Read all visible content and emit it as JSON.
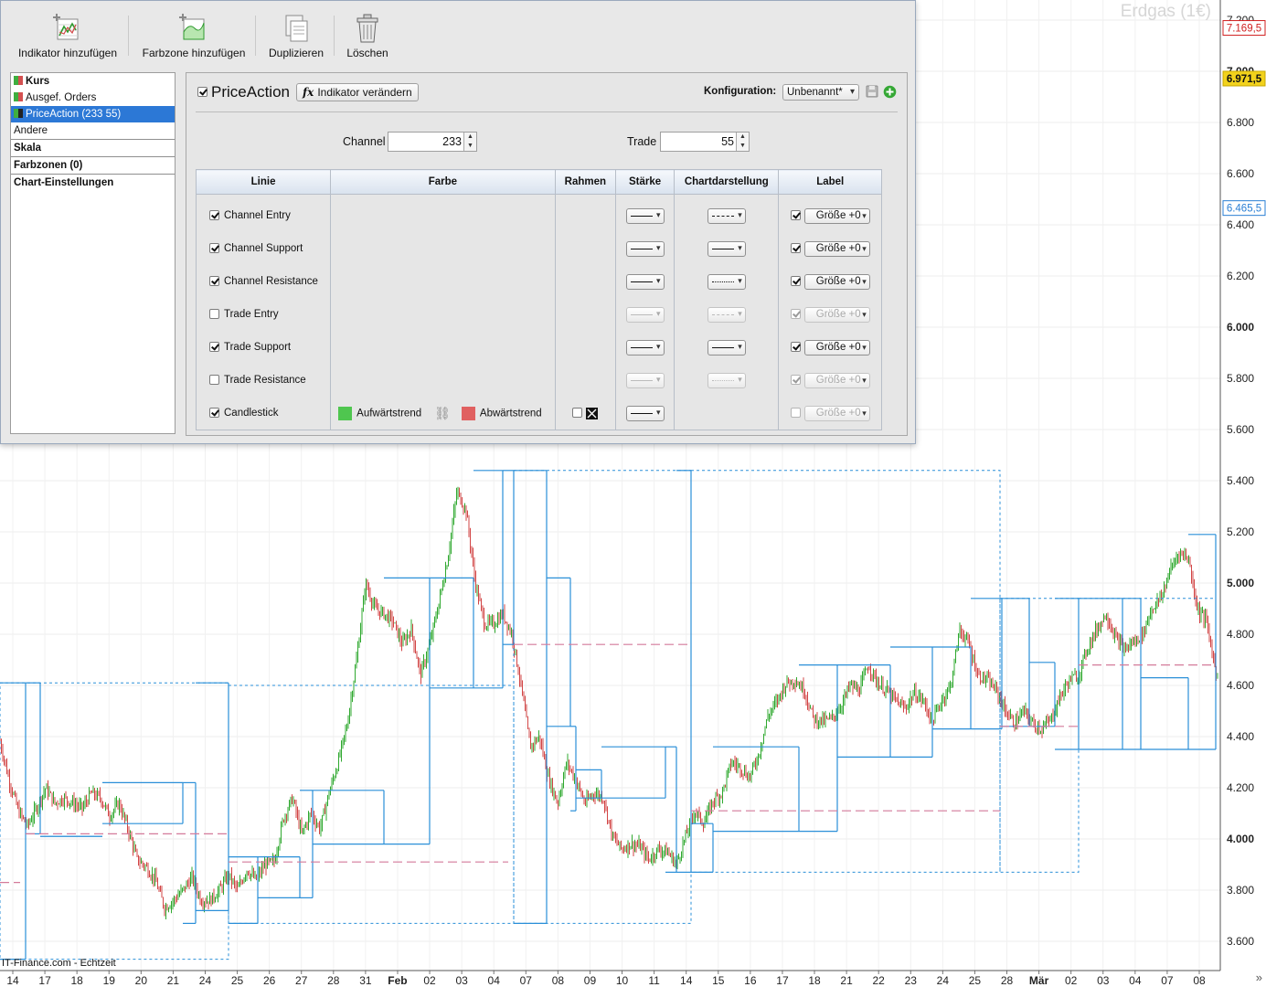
{
  "chart": {
    "watermark": "Erdgas (1€)",
    "source": "IT-Finance.com - Echtzeit",
    "y_ticks": [
      "7.200",
      "7.000",
      "6.800",
      "6.600",
      "6.400",
      "6.200",
      "6.000",
      "5.800",
      "5.600",
      "5.400",
      "5.200",
      "5.000",
      "4.800",
      "4.600",
      "4.400",
      "4.200",
      "4.000",
      "3.800",
      "3.600"
    ],
    "y_bold": [
      "7.000",
      "6.000",
      "5.000",
      "4.000"
    ],
    "price_badges": [
      {
        "label": "7.169,5",
        "value": 7169.5,
        "bg": "#ffffff",
        "fg": "#d02020",
        "border": "#d02020"
      },
      {
        "label": "6.971,5",
        "value": 6971.5,
        "bg": "#f2d21c",
        "fg": "#111111",
        "border": "#c7a700"
      },
      {
        "label": "6.465,5",
        "value": 6465.5,
        "bg": "#ffffff",
        "fg": "#2a7fd4",
        "border": "#2a7fd4"
      }
    ],
    "x_ticks": [
      "14",
      "17",
      "18",
      "19",
      "20",
      "21",
      "24",
      "25",
      "26",
      "27",
      "28",
      "31",
      "Feb",
      "02",
      "03",
      "04",
      "07",
      "08",
      "09",
      "10",
      "11",
      "14",
      "15",
      "16",
      "17",
      "18",
      "21",
      "22",
      "23",
      "24",
      "25",
      "28",
      "Mär",
      "02",
      "03",
      "04",
      "07",
      "08"
    ],
    "x_bold": [
      "Feb",
      "Mär"
    ],
    "colors": {
      "up": "#2fa82f",
      "down": "#d24545",
      "channel": "#2a8fd8",
      "midline": "#d47a9a"
    }
  },
  "chart_data": {
    "type": "candlestick",
    "ylim": [
      3500,
      7230
    ],
    "channel": [
      {
        "x0": 0,
        "x1": 28,
        "top": 4610,
        "bottom": 3530
      },
      {
        "x0": 28,
        "x1": 44,
        "top": 4610,
        "bottom": 4020
      },
      {
        "x0": 44,
        "x1": 112,
        "top": 4010,
        "bottom": 4010
      },
      {
        "x0": 112,
        "x1": 200,
        "top": 4220,
        "bottom": 4060
      },
      {
        "x0": 200,
        "x1": 214,
        "top": 4220,
        "bottom": 3670
      },
      {
        "x0": 214,
        "x1": 250,
        "top": 4610,
        "bottom": 3720
      },
      {
        "x0": 250,
        "x1": 282,
        "top": 3930,
        "bottom": 3670
      },
      {
        "x0": 282,
        "x1": 328,
        "top": 3930,
        "bottom": 3770
      },
      {
        "x0": 328,
        "x1": 342,
        "top": 4190,
        "bottom": 3770
      },
      {
        "x0": 342,
        "x1": 420,
        "top": 4190,
        "bottom": 3980
      },
      {
        "x0": 420,
        "x1": 470,
        "top": 5020,
        "bottom": 3980
      },
      {
        "x0": 470,
        "x1": 518,
        "top": 5020,
        "bottom": 4590
      },
      {
        "x0": 518,
        "x1": 550,
        "top": 5440,
        "bottom": 4590
      },
      {
        "x0": 550,
        "x1": 562,
        "top": 5440,
        "bottom": 4760
      },
      {
        "x0": 562,
        "x1": 598,
        "top": 5440,
        "bottom": 3670
      },
      {
        "x0": 598,
        "x1": 624,
        "top": 5020,
        "bottom": 4440
      },
      {
        "x0": 624,
        "x1": 630,
        "top": 4440,
        "bottom": 4110
      },
      {
        "x0": 630,
        "x1": 658,
        "top": 4270,
        "bottom": 4160
      },
      {
        "x0": 658,
        "x1": 728,
        "top": 4360,
        "bottom": 4160
      },
      {
        "x0": 728,
        "x1": 740,
        "top": 4360,
        "bottom": 3870
      },
      {
        "x0": 740,
        "x1": 756,
        "top": 5440,
        "bottom": 3870
      },
      {
        "x0": 756,
        "x1": 780,
        "top": 4060,
        "bottom": 3870
      },
      {
        "x0": 780,
        "x1": 874,
        "top": 4360,
        "bottom": 4030
      },
      {
        "x0": 874,
        "x1": 916,
        "top": 4680,
        "bottom": 4030
      },
      {
        "x0": 916,
        "x1": 974,
        "top": 4680,
        "bottom": 4320
      },
      {
        "x0": 974,
        "x1": 1020,
        "top": 4750,
        "bottom": 4320
      },
      {
        "x0": 1020,
        "x1": 1062,
        "top": 4750,
        "bottom": 4430
      },
      {
        "x0": 1062,
        "x1": 1096,
        "top": 4940,
        "bottom": 4430
      },
      {
        "x0": 1096,
        "x1": 1126,
        "top": 4940,
        "bottom": 4440
      },
      {
        "x0": 1126,
        "x1": 1154,
        "top": 4690,
        "bottom": 4440
      },
      {
        "x0": 1154,
        "x1": 1180,
        "top": 4940,
        "bottom": 4350
      },
      {
        "x0": 1180,
        "x1": 1228,
        "top": 4940,
        "bottom": 4350
      },
      {
        "x0": 1228,
        "x1": 1248,
        "top": 4940,
        "bottom": 4350
      },
      {
        "x0": 1248,
        "x1": 1300,
        "top": 4630,
        "bottom": 4350
      },
      {
        "x0": 1300,
        "x1": 1330,
        "top": 5190,
        "bottom": 4350
      }
    ],
    "entry": [
      {
        "x0": 0,
        "x1": 250,
        "top": 4610,
        "bottom": 3530
      },
      {
        "x0": 250,
        "x1": 562,
        "top": 4600,
        "bottom": 3670
      },
      {
        "x0": 562,
        "x1": 756,
        "top": 5440,
        "bottom": 3670
      },
      {
        "x0": 756,
        "x1": 1094,
        "top": 5440,
        "bottom": 3870
      },
      {
        "x0": 1094,
        "x1": 1180,
        "top": 4940,
        "bottom": 3870
      },
      {
        "x0": 1180,
        "x1": 1330,
        "top": 4940,
        "bottom": 4350
      }
    ],
    "midlines": [
      {
        "x0": 0,
        "x1": 22,
        "y": 3830
      },
      {
        "x0": 28,
        "x1": 250,
        "y": 4020
      },
      {
        "x0": 250,
        "x1": 556,
        "y": 3910
      },
      {
        "x0": 562,
        "x1": 756,
        "y": 4760
      },
      {
        "x0": 756,
        "x1": 1094,
        "y": 4110
      },
      {
        "x0": 1094,
        "x1": 1180,
        "y": 4440
      },
      {
        "x0": 1180,
        "x1": 1330,
        "y": 4680
      }
    ],
    "path": [
      [
        0,
        4380
      ],
      [
        10,
        4230
      ],
      [
        20,
        4110
      ],
      [
        30,
        4050
      ],
      [
        40,
        4120
      ],
      [
        50,
        4200
      ],
      [
        60,
        4140
      ],
      [
        70,
        4160
      ],
      [
        80,
        4140
      ],
      [
        90,
        4120
      ],
      [
        100,
        4180
      ],
      [
        110,
        4160
      ],
      [
        120,
        4090
      ],
      [
        130,
        4140
      ],
      [
        140,
        4040
      ],
      [
        150,
        3920
      ],
      [
        160,
        3890
      ],
      [
        170,
        3840
      ],
      [
        180,
        3730
      ],
      [
        190,
        3760
      ],
      [
        200,
        3800
      ],
      [
        210,
        3850
      ],
      [
        220,
        3760
      ],
      [
        230,
        3760
      ],
      [
        240,
        3800
      ],
      [
        250,
        3860
      ],
      [
        260,
        3800
      ],
      [
        270,
        3880
      ],
      [
        280,
        3840
      ],
      [
        290,
        3900
      ],
      [
        300,
        3910
      ],
      [
        310,
        4080
      ],
      [
        320,
        4160
      ],
      [
        330,
        4020
      ],
      [
        340,
        4100
      ],
      [
        350,
        4040
      ],
      [
        360,
        4180
      ],
      [
        370,
        4300
      ],
      [
        380,
        4450
      ],
      [
        390,
        4700
      ],
      [
        400,
        5000
      ],
      [
        410,
        4900
      ],
      [
        420,
        4880
      ],
      [
        430,
        4850
      ],
      [
        440,
        4760
      ],
      [
        450,
        4820
      ],
      [
        460,
        4640
      ],
      [
        470,
        4760
      ],
      [
        480,
        4920
      ],
      [
        490,
        5100
      ],
      [
        500,
        5360
      ],
      [
        510,
        5280
      ],
      [
        520,
        5000
      ],
      [
        530,
        4840
      ],
      [
        540,
        4840
      ],
      [
        550,
        4880
      ],
      [
        560,
        4800
      ],
      [
        570,
        4600
      ],
      [
        580,
        4360
      ],
      [
        590,
        4400
      ],
      [
        600,
        4240
      ],
      [
        610,
        4140
      ],
      [
        620,
        4300
      ],
      [
        630,
        4230
      ],
      [
        640,
        4140
      ],
      [
        650,
        4180
      ],
      [
        660,
        4160
      ],
      [
        670,
        4010
      ],
      [
        680,
        3960
      ],
      [
        690,
        3980
      ],
      [
        700,
        3970
      ],
      [
        710,
        3920
      ],
      [
        720,
        3960
      ],
      [
        730,
        3950
      ],
      [
        740,
        3900
      ],
      [
        750,
        4010
      ],
      [
        760,
        4110
      ],
      [
        770,
        4060
      ],
      [
        780,
        4150
      ],
      [
        790,
        4180
      ],
      [
        800,
        4300
      ],
      [
        810,
        4280
      ],
      [
        820,
        4240
      ],
      [
        830,
        4330
      ],
      [
        840,
        4480
      ],
      [
        850,
        4540
      ],
      [
        860,
        4610
      ],
      [
        870,
        4620
      ],
      [
        880,
        4580
      ],
      [
        890,
        4470
      ],
      [
        900,
        4460
      ],
      [
        910,
        4470
      ],
      [
        920,
        4520
      ],
      [
        930,
        4600
      ],
      [
        940,
        4580
      ],
      [
        950,
        4680
      ],
      [
        960,
        4610
      ],
      [
        970,
        4580
      ],
      [
        980,
        4540
      ],
      [
        990,
        4510
      ],
      [
        1000,
        4570
      ],
      [
        1010,
        4540
      ],
      [
        1020,
        4460
      ],
      [
        1030,
        4540
      ],
      [
        1040,
        4600
      ],
      [
        1050,
        4820
      ],
      [
        1060,
        4760
      ],
      [
        1070,
        4640
      ],
      [
        1080,
        4620
      ],
      [
        1090,
        4580
      ],
      [
        1100,
        4500
      ],
      [
        1110,
        4450
      ],
      [
        1120,
        4500
      ],
      [
        1130,
        4450
      ],
      [
        1140,
        4430
      ],
      [
        1150,
        4470
      ],
      [
        1160,
        4560
      ],
      [
        1170,
        4620
      ],
      [
        1180,
        4640
      ],
      [
        1190,
        4750
      ],
      [
        1200,
        4820
      ],
      [
        1210,
        4880
      ],
      [
        1220,
        4790
      ],
      [
        1230,
        4740
      ],
      [
        1240,
        4770
      ],
      [
        1250,
        4800
      ],
      [
        1260,
        4900
      ],
      [
        1270,
        4940
      ],
      [
        1280,
        5050
      ],
      [
        1290,
        5120
      ],
      [
        1300,
        5100
      ],
      [
        1310,
        4900
      ],
      [
        1320,
        4850
      ],
      [
        1330,
        4650
      ]
    ]
  },
  "dialog": {
    "toolbar": [
      {
        "label": "Indikator hinzufügen",
        "icon": "add-indicator-icon"
      },
      {
        "label": "Farbzone hinzufügen",
        "icon": "add-colorzone-icon"
      },
      {
        "label": "Duplizieren",
        "icon": "duplicate-icon"
      },
      {
        "label": "Löschen",
        "icon": "trash-icon"
      }
    ],
    "left_items": [
      {
        "label": "Kurs",
        "bold": true,
        "swatch": true
      },
      {
        "label": "Ausgef. Orders",
        "bold": false,
        "swatch": true
      },
      {
        "label": "PriceAction (233 55)",
        "bold": false,
        "swatch": true,
        "selected": true
      },
      {
        "label": "Andere",
        "bold": false
      },
      {
        "label": "Skala",
        "bold": true
      },
      {
        "label": "Farbzonen (0)",
        "bold": true
      },
      {
        "label": "Chart-Einstellungen",
        "bold": true
      }
    ],
    "indicator_name": "PriceAction",
    "change_button": "Indikator verändern",
    "config_label": "Konfiguration:",
    "config_value": "Unbenannt*",
    "channel_label": "Channel",
    "channel_value": "233",
    "trade_label": "Trade",
    "trade_value": "55",
    "table_headers": [
      "Linie",
      "Farbe",
      "Rahmen",
      "Stärke",
      "Chartdarstellung",
      "Label"
    ],
    "rows": [
      {
        "name": "Channel Entry",
        "checked": true,
        "style": "dash",
        "enabled": true,
        "label_checked": true,
        "label": "Größe +0"
      },
      {
        "name": "Channel Support",
        "checked": true,
        "style": "solid",
        "enabled": true,
        "label_checked": true,
        "label": "Größe +0"
      },
      {
        "name": "Channel Resistance",
        "checked": true,
        "style": "dot",
        "enabled": true,
        "label_checked": true,
        "label": "Größe +0"
      },
      {
        "name": "Trade Entry",
        "checked": false,
        "style": "dash",
        "enabled": false,
        "label_checked": true,
        "label": "Größe +0"
      },
      {
        "name": "Trade Support",
        "checked": true,
        "style": "solid",
        "enabled": true,
        "label_checked": true,
        "label": "Größe +0"
      },
      {
        "name": "Trade Resistance",
        "checked": false,
        "style": "dot",
        "enabled": false,
        "label_checked": true,
        "label": "Größe +0"
      }
    ],
    "candlestick": {
      "name": "Candlestick",
      "up_label": "Aufwärtstrend",
      "down_label": "Abwärtstrend",
      "up_color": "#4fc64f",
      "down_color": "#e06060",
      "label": "Größe +0"
    }
  }
}
